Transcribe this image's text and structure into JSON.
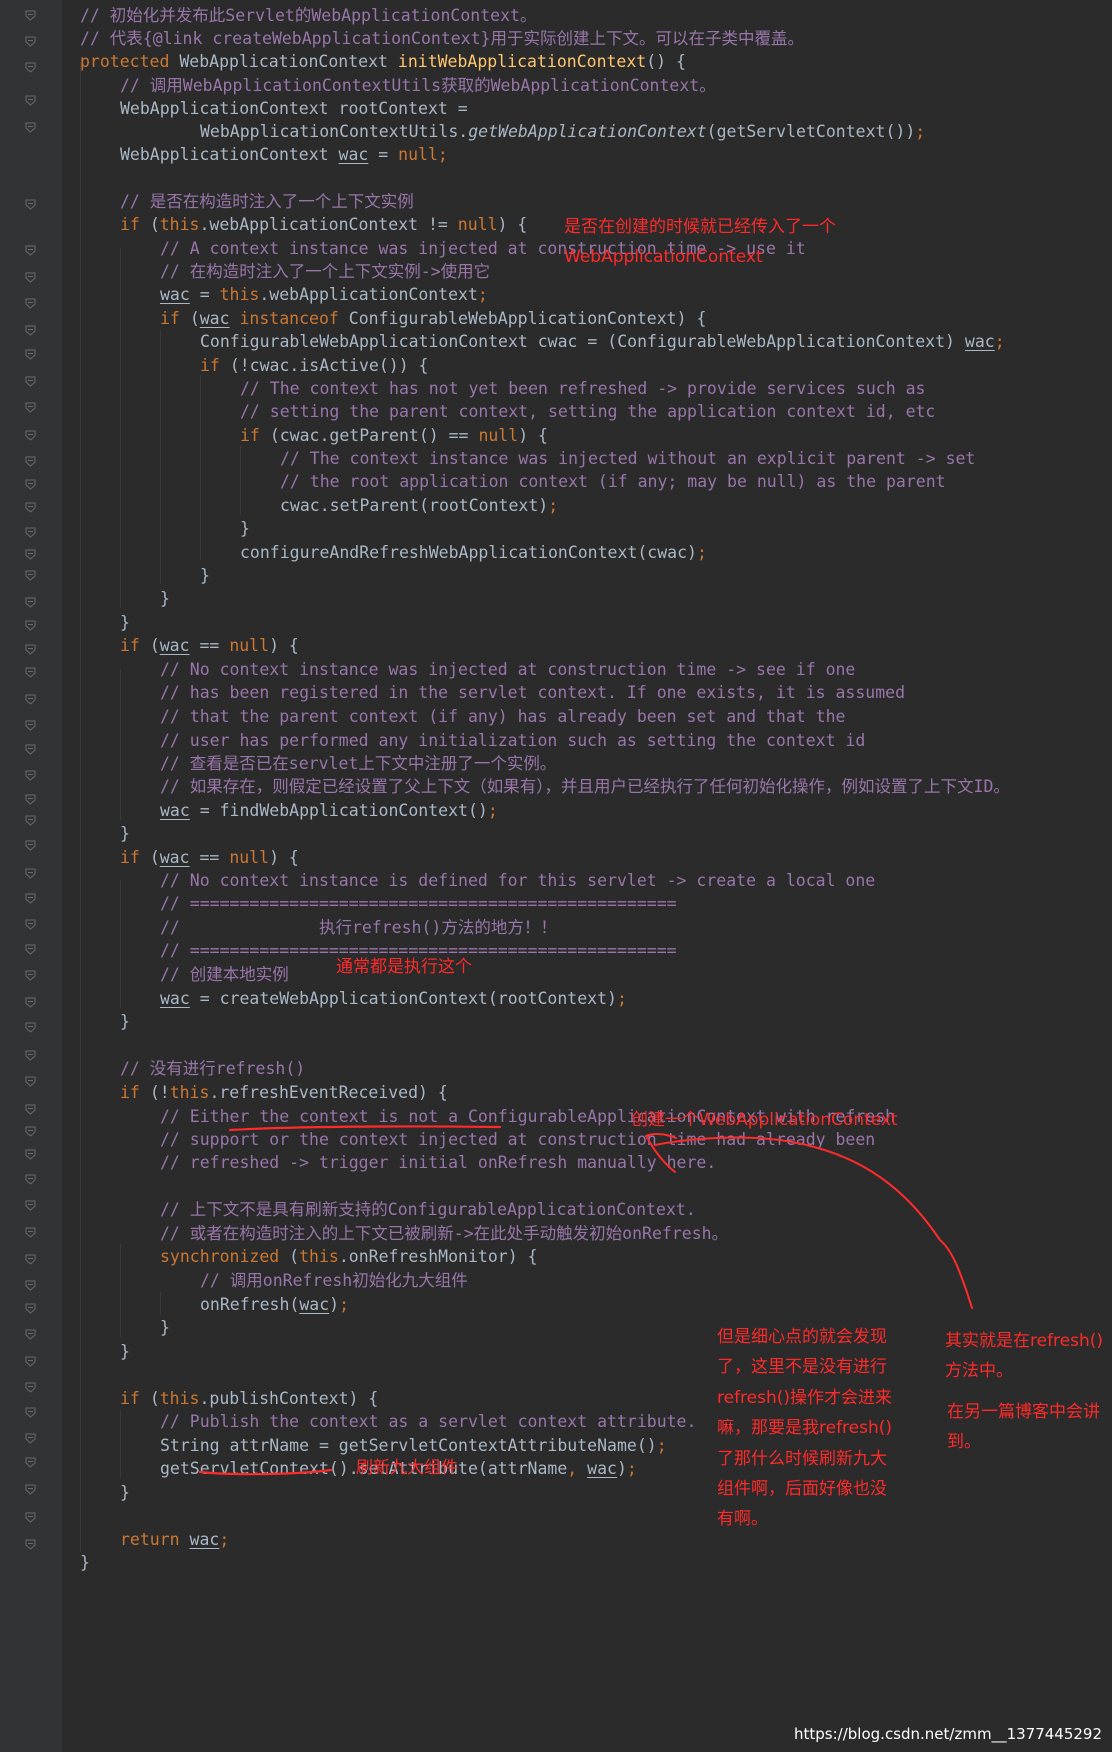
{
  "code_lines": [
    [
      {
        "c": "cm",
        "t": "// 初始化并发布此Servlet的WebApplicationContext。"
      }
    ],
    [
      {
        "c": "cm",
        "t": "// 代表{@link createWebApplicationContext}用于实际创建上下文。可以在子类中覆盖。"
      }
    ],
    [
      {
        "c": "kw",
        "t": "protected "
      },
      {
        "c": "",
        "t": "WebApplicationContext "
      },
      {
        "c": "fn",
        "t": "initWebApplicationContext"
      },
      {
        "c": "",
        "t": "() {"
      }
    ],
    [
      {
        "c": "cm",
        "t": "// 调用WebApplicationContextUtils获取的WebApplicationContext。"
      }
    ],
    [
      {
        "c": "",
        "t": "WebApplicationContext rootContext ="
      }
    ],
    [
      {
        "c": "",
        "t": "WebApplicationContextUtils."
      },
      {
        "c": "it",
        "t": "getWebApplicationContext"
      },
      {
        "c": "",
        "t": "(getServletContext())"
      },
      {
        "c": "kw",
        "t": ";"
      }
    ],
    [
      {
        "c": "",
        "t": "WebApplicationContext "
      },
      {
        "c": "ul",
        "t": "wac"
      },
      {
        "c": "",
        "t": " = "
      },
      {
        "c": "kw",
        "t": "null;"
      }
    ],
    [],
    [
      {
        "c": "cm",
        "t": "// 是否在构造时注入了一个上下文实例"
      }
    ],
    [
      {
        "c": "kw",
        "t": "if "
      },
      {
        "c": "",
        "t": "("
      },
      {
        "c": "kw",
        "t": "this"
      },
      {
        "c": "",
        "t": ".webApplicationContext != "
      },
      {
        "c": "kw",
        "t": "null"
      },
      {
        "c": "",
        "t": ") {"
      }
    ],
    [
      {
        "c": "cm",
        "t": "// A context instance was injected at construction time -> use it"
      }
    ],
    [
      {
        "c": "cm",
        "t": "// 在构造时注入了一个上下文实例->使用它"
      }
    ],
    [
      {
        "c": "ul",
        "t": "wac"
      },
      {
        "c": "",
        "t": " = "
      },
      {
        "c": "kw",
        "t": "this"
      },
      {
        "c": "",
        "t": ".webApplicationContext"
      },
      {
        "c": "kw",
        "t": ";"
      }
    ],
    [
      {
        "c": "kw",
        "t": "if "
      },
      {
        "c": "",
        "t": "("
      },
      {
        "c": "ul",
        "t": "wac"
      },
      {
        "c": "kw",
        "t": " instanceof "
      },
      {
        "c": "",
        "t": "ConfigurableWebApplicationContext) {"
      }
    ],
    [
      {
        "c": "",
        "t": "ConfigurableWebApplicationContext cwac = (ConfigurableWebApplicationContext) "
      },
      {
        "c": "ul",
        "t": "wac"
      },
      {
        "c": "kw",
        "t": ";"
      }
    ],
    [
      {
        "c": "kw",
        "t": "if "
      },
      {
        "c": "",
        "t": "(!cwac.isActive()) {"
      }
    ],
    [
      {
        "c": "cm",
        "t": "// The context has not yet been refreshed -> provide services such as"
      }
    ],
    [
      {
        "c": "cm",
        "t": "// setting the parent context, setting the application context id, etc"
      }
    ],
    [
      {
        "c": "kw",
        "t": "if "
      },
      {
        "c": "",
        "t": "(cwac.getParent() == "
      },
      {
        "c": "kw",
        "t": "null"
      },
      {
        "c": "",
        "t": ") {"
      }
    ],
    [
      {
        "c": "cm",
        "t": "// The context instance was injected without an explicit parent -> set"
      }
    ],
    [
      {
        "c": "cm",
        "t": "// the root application context (if any; may be null) as the parent"
      }
    ],
    [
      {
        "c": "",
        "t": "cwac.setParent(rootContext)"
      },
      {
        "c": "kw",
        "t": ";"
      }
    ],
    [
      {
        "c": "",
        "t": "}"
      }
    ],
    [
      {
        "c": "",
        "t": "configureAndRefreshWebApplicationContext(cwac)"
      },
      {
        "c": "kw",
        "t": ";"
      }
    ],
    [
      {
        "c": "",
        "t": "}"
      }
    ],
    [
      {
        "c": "",
        "t": "}"
      }
    ],
    [
      {
        "c": "",
        "t": "}"
      }
    ],
    [
      {
        "c": "kw",
        "t": "if "
      },
      {
        "c": "",
        "t": "("
      },
      {
        "c": "ul",
        "t": "wac"
      },
      {
        "c": "",
        "t": " == "
      },
      {
        "c": "kw",
        "t": "null"
      },
      {
        "c": "",
        "t": ") {"
      }
    ],
    [
      {
        "c": "cm",
        "t": "// No context instance was injected at construction time -> see if one"
      }
    ],
    [
      {
        "c": "cm",
        "t": "// has been registered in the servlet context. If one exists, it is assumed"
      }
    ],
    [
      {
        "c": "cm",
        "t": "// that the parent context (if any) has already been set and that the"
      }
    ],
    [
      {
        "c": "cm",
        "t": "// user has performed any initialization such as setting the context id"
      }
    ],
    [
      {
        "c": "cm",
        "t": "// 查看是否已在servlet上下文中注册了一个实例。"
      }
    ],
    [
      {
        "c": "cm",
        "t": "// 如果存在，则假定已经设置了父上下文（如果有），并且用户已经执行了任何初始化操作，例如设置了上下文ID。"
      }
    ],
    [
      {
        "c": "ul",
        "t": "wac"
      },
      {
        "c": "",
        "t": " = findWebApplicationContext()"
      },
      {
        "c": "kw",
        "t": ";"
      }
    ],
    [
      {
        "c": "",
        "t": "}"
      }
    ],
    [
      {
        "c": "kw",
        "t": "if "
      },
      {
        "c": "",
        "t": "("
      },
      {
        "c": "ul",
        "t": "wac"
      },
      {
        "c": "",
        "t": " == "
      },
      {
        "c": "kw",
        "t": "null"
      },
      {
        "c": "",
        "t": ") {"
      }
    ],
    [
      {
        "c": "cm",
        "t": "// No context instance is defined for this servlet -> create a local one"
      }
    ],
    [
      {
        "c": "cm",
        "t": "// ================================================="
      }
    ],
    [
      {
        "c": "cm",
        "t": "//              执行refresh()方法的地方！！"
      }
    ],
    [
      {
        "c": "cm",
        "t": "// ================================================="
      }
    ],
    [
      {
        "c": "cm",
        "t": "// 创建本地实例"
      }
    ],
    [
      {
        "c": "ul",
        "t": "wac"
      },
      {
        "c": "",
        "t": " = createWebApplicationContext(rootContext)"
      },
      {
        "c": "kw",
        "t": ";"
      }
    ],
    [
      {
        "c": "",
        "t": "}"
      }
    ],
    [],
    [
      {
        "c": "cm",
        "t": "// 没有进行refresh()"
      }
    ],
    [
      {
        "c": "kw",
        "t": "if "
      },
      {
        "c": "",
        "t": "(!"
      },
      {
        "c": "kw",
        "t": "this"
      },
      {
        "c": "",
        "t": ".refreshEventReceived) {"
      }
    ],
    [
      {
        "c": "cm",
        "t": "// Either the context is not a ConfigurableApplicationContext with refresh"
      }
    ],
    [
      {
        "c": "cm",
        "t": "// support or the context injected at construction time had already been"
      }
    ],
    [
      {
        "c": "cm",
        "t": "// refreshed -> trigger initial onRefresh manually here."
      }
    ],
    [],
    [
      {
        "c": "cm",
        "t": "// 上下文不是具有刷新支持的ConfigurableApplicationContext."
      }
    ],
    [
      {
        "c": "cm",
        "t": "// 或者在构造时注入的上下文已被刷新->在此处手动触发初始onRefresh。"
      }
    ],
    [
      {
        "c": "kw",
        "t": "synchronized "
      },
      {
        "c": "",
        "t": "("
      },
      {
        "c": "kw",
        "t": "this"
      },
      {
        "c": "",
        "t": ".onRefreshMonitor) {"
      }
    ],
    [
      {
        "c": "cm",
        "t": "// 调用onRefresh初始化九大组件"
      }
    ],
    [
      {
        "c": "",
        "t": "onRefresh("
      },
      {
        "c": "ul",
        "t": "wac"
      },
      {
        "c": "",
        "t": ")"
      },
      {
        "c": "kw",
        "t": ";"
      }
    ],
    [
      {
        "c": "",
        "t": "}"
      }
    ],
    [
      {
        "c": "",
        "t": "}"
      }
    ],
    [],
    [
      {
        "c": "kw",
        "t": "if "
      },
      {
        "c": "",
        "t": "("
      },
      {
        "c": "kw",
        "t": "this"
      },
      {
        "c": "",
        "t": ".publishContext) {"
      }
    ],
    [
      {
        "c": "cm",
        "t": "// Publish the context as a servlet context attribute."
      }
    ],
    [
      {
        "c": "",
        "t": "String attrName = getServletContextAttributeName()"
      },
      {
        "c": "kw",
        "t": ";"
      }
    ],
    [
      {
        "c": "",
        "t": "getServletContext().setAttribute(attrName"
      },
      {
        "c": "kw",
        "t": ", "
      },
      {
        "c": "ul",
        "t": "wac"
      },
      {
        "c": "",
        "t": ")"
      },
      {
        "c": "kw",
        "t": ";"
      }
    ],
    [
      {
        "c": "",
        "t": "}"
      }
    ],
    [],
    [
      {
        "c": "kw",
        "t": "return "
      },
      {
        "c": "ul",
        "t": "wac"
      },
      {
        "c": "kw",
        "t": ";"
      }
    ],
    [
      {
        "c": "",
        "t": "}"
      }
    ]
  ],
  "annotations": {
    "note_injected_at_creation": "是否在创建的时候就已经传入了一个\nWebApplicationContext",
    "note_usually_runs_this": "通常都是执行这个",
    "note_create_context": "创建一个WebApplicationContext",
    "note_refresh_nine_components": "刷新九大组件",
    "note_careful_readers": "但是细心点的就会发现\n了，这里不是没有进行\nrefresh()操作才会进来\n嘛，那要是我refresh()\n了那什么时候刷新九大\n组件啊，后面好像也没\n有啊。",
    "note_actually_in_refresh": "其实就是在refresh()\n方法中。",
    "note_another_blog": "在另一篇博客中会讲\n到。"
  },
  "watermark": "https://blog.csdn.net/zmm__1377445292",
  "colors": {
    "background": "#2b2b2b",
    "gutter": "#313335",
    "keyword": "#cc7832",
    "comment": "#9876aa",
    "method": "#ffc66d",
    "text": "#a9b7c6",
    "annotation": "#ff2a2a"
  }
}
